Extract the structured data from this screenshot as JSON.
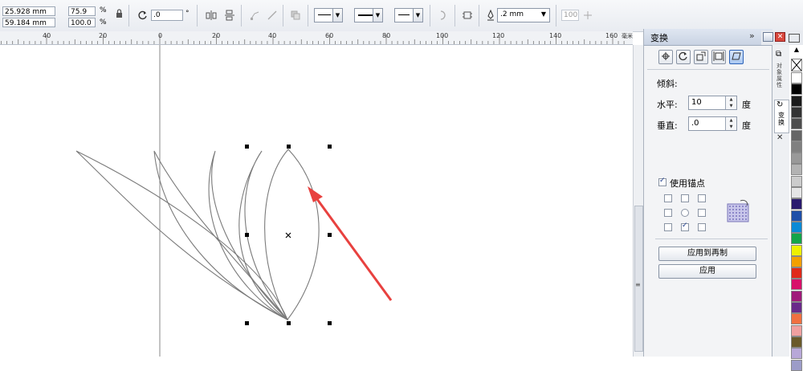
{
  "propbar": {
    "x_value": "25.928 mm",
    "y_value": "59.184 mm",
    "scale_x": "75.9",
    "scale_y": "100.0",
    "percent_symbol": "%",
    "rotation": ".0",
    "degree_symbol": "°",
    "outline_width": ".2 mm",
    "mirror_value": "100"
  },
  "ruler": {
    "labels": [
      "40",
      "20",
      "0",
      "20",
      "40",
      "60",
      "80",
      "100",
      "120",
      "140",
      "160"
    ],
    "unit": "毫米"
  },
  "docker": {
    "title": "变换",
    "section_label": "倾斜:",
    "horizontal_label": "水平:",
    "horizontal_value": "10",
    "vertical_label": "垂直:",
    "vertical_value": ".0",
    "degree_unit": "度",
    "use_anchor_label": "使用锚点",
    "apply_to_duplicate_label": "应用到再制",
    "apply_label": "应用"
  },
  "side_tabs": {
    "object_properties": "对象属性",
    "transform": "变换"
  },
  "palette": {
    "colors": [
      "#ffffff",
      "#000000",
      "#1a1a1a",
      "#333333",
      "#4d4d4d",
      "#666666",
      "#808080",
      "#999999",
      "#b3b3b3",
      "#cccccc",
      "#e6e6e6",
      "#2a1a6e",
      "#1f4fa8",
      "#0a8ad6",
      "#13a54a",
      "#eef000",
      "#f3a000",
      "#e02a1a",
      "#d8106a",
      "#a01a7a",
      "#6a2a8a",
      "#f07040",
      "#f0a0a0",
      "#6a5a2a",
      "#b8a8d8",
      "#9c9cc8"
    ]
  },
  "colors": {
    "annotation_arrow": "#e8413f"
  }
}
